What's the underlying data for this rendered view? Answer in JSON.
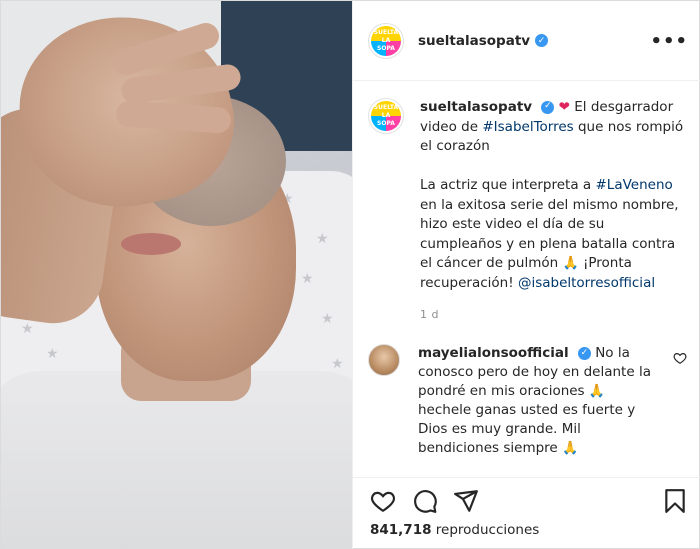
{
  "post": {
    "username": "sueltalasopatv",
    "more_label": "•••",
    "logo_line1": "SUELTA",
    "logo_line2": "LA",
    "logo_line3": "SOPA"
  },
  "caption": {
    "username": "sueltalasopatv",
    "heart": "❤",
    "text_1": "El desgarrador video de ",
    "hashtag_1": "#IsabelTorres",
    "text_2": " que nos rompió el corazón",
    "text_3": "La actriz que interpreta a ",
    "hashtag_2": "#LaVeneno",
    "text_4": " en la exitosa serie del mismo nombre, hizo este video el día de su cumpleaños y en plena batalla contra el cáncer de pulmón ",
    "pray": "🙏",
    "text_5": " ¡Pronta recuperación! ",
    "mention": "@isabeltorresofficial",
    "time": "1 d"
  },
  "comment": {
    "username": "mayelialonsoofficial",
    "text_1": " No la conosco pero de hoy en delante la pondré en mis oraciones ",
    "pray_1": "🙏",
    "text_2": " hechele ganas usted es fuerte y Dios es muy grande. Mil bendiciones siempre ",
    "pray_2": "🙏"
  },
  "stats": {
    "views_count": "841,718",
    "views_label": " reproducciones"
  },
  "icons": [
    "heart-icon",
    "comment-icon",
    "share-icon",
    "bookmark-icon",
    "more-icon",
    "verified-icon"
  ]
}
